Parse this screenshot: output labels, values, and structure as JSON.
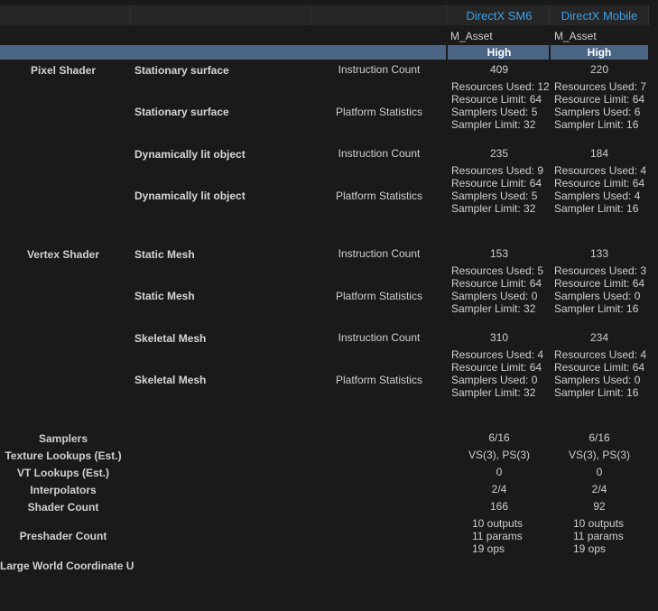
{
  "header": {
    "platforms": [
      "DirectX SM6",
      "DirectX  Mobile"
    ],
    "asset_labels": [
      "M_Asset",
      "M_Asset"
    ],
    "quality": [
      "High",
      "High"
    ]
  },
  "pixel_shader": {
    "label": "Pixel Shader",
    "rows": [
      {
        "vf": "Stationary surface",
        "stat": "Instruction Count",
        "c1": "409",
        "c2": "220"
      },
      {
        "vf": "Stationary surface",
        "stat": "Platform Statistics",
        "c1": [
          "Resources Used: 12",
          "Resource Limit: 64",
          "Samplers Used: 5",
          "Sampler Limit: 32"
        ],
        "c2": [
          "Resources Used: 7",
          "Resource Limit: 64",
          "Samplers Used: 6",
          "Sampler Limit: 16"
        ]
      },
      {
        "vf": "Dynamically lit object",
        "stat": "Instruction Count",
        "c1": "235",
        "c2": "184"
      },
      {
        "vf": "Dynamically lit object",
        "stat": "Platform Statistics",
        "c1": [
          "Resources Used: 9",
          "Resource Limit: 64",
          "Samplers Used: 5",
          "Sampler Limit: 32"
        ],
        "c2": [
          "Resources Used: 4",
          "Resource Limit: 64",
          "Samplers Used: 4",
          "Sampler Limit: 16"
        ]
      }
    ]
  },
  "vertex_shader": {
    "label": "Vertex Shader",
    "rows": [
      {
        "vf": "Static Mesh",
        "stat": "Instruction Count",
        "c1": "153",
        "c2": "133"
      },
      {
        "vf": "Static Mesh",
        "stat": "Platform Statistics",
        "c1": [
          "Resources Used: 5",
          "Resource Limit: 64",
          "Samplers Used: 0",
          "Sampler Limit: 32"
        ],
        "c2": [
          "Resources Used: 3",
          "Resource Limit: 64",
          "Samplers Used: 0",
          "Sampler Limit: 16"
        ]
      },
      {
        "vf": "Skeletal Mesh",
        "stat": "Instruction Count",
        "c1": "310",
        "c2": "234"
      },
      {
        "vf": "Skeletal Mesh",
        "stat": "Platform Statistics",
        "c1": [
          "Resources Used: 4",
          "Resource Limit: 64",
          "Samplers Used: 0",
          "Sampler Limit: 32"
        ],
        "c2": [
          "Resources Used: 4",
          "Resource Limit: 64",
          "Samplers Used: 0",
          "Sampler Limit: 16"
        ]
      }
    ]
  },
  "summary": [
    {
      "label": "Samplers",
      "c1": "6/16",
      "c2": "6/16"
    },
    {
      "label": "Texture Lookups (Est.)",
      "c1": "VS(3), PS(3)",
      "c2": "VS(3), PS(3)"
    },
    {
      "label": "VT Lookups (Est.)",
      "c1": "0",
      "c2": "0"
    },
    {
      "label": "Interpolators",
      "c1": "2/4",
      "c2": "2/4"
    },
    {
      "label": "Shader Count",
      "c1": "166",
      "c2": "92"
    },
    {
      "label": "Preshader Count",
      "c1": [
        "10 outputs",
        "11 params",
        "19 ops"
      ],
      "c2": [
        "10 outputs",
        "11 params",
        "19 ops"
      ]
    },
    {
      "label": "Large World Coordinate U"
    }
  ]
}
